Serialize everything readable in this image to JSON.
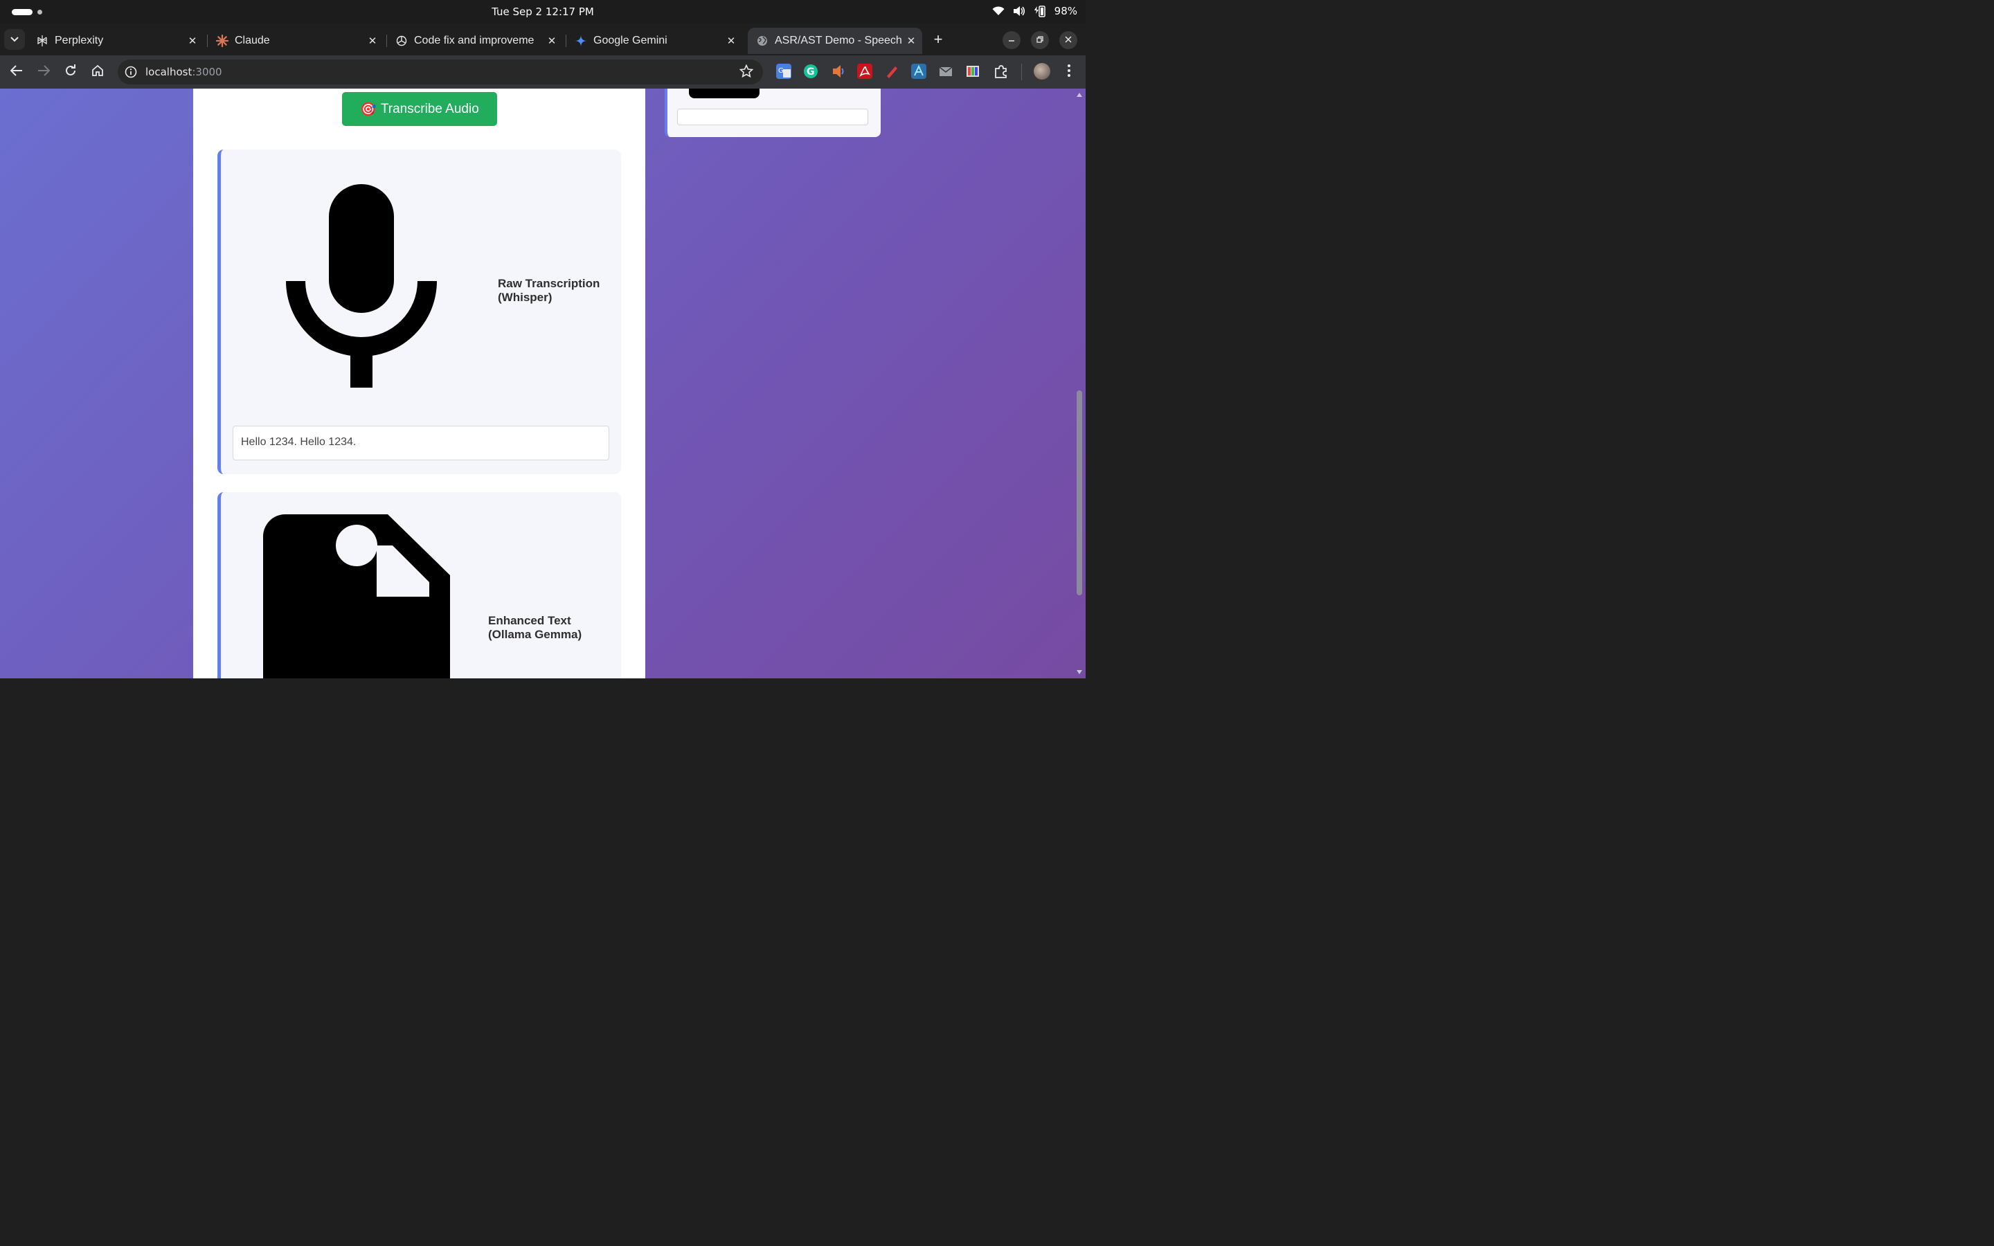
{
  "os": {
    "datetime": "Tue Sep 2  12:17 PM",
    "battery": "98%",
    "icons": [
      "wifi-icon",
      "volume-icon",
      "battery-icon"
    ]
  },
  "browser": {
    "tabs": [
      {
        "title": "Perplexity",
        "icon": "perplexity-icon",
        "active": false
      },
      {
        "title": "Claude",
        "icon": "claude-icon",
        "active": false
      },
      {
        "title": "Code fix and improveme",
        "icon": "chatgpt-icon",
        "active": false
      },
      {
        "title": "Google Gemini",
        "icon": "gemini-icon",
        "active": false
      },
      {
        "title": "ASR/AST Demo - Speech",
        "icon": "globe-icon",
        "active": true
      }
    ],
    "url_host": "localhost",
    "url_port": ":3000",
    "extensions": [
      "google-translate-icon",
      "grammarly-icon",
      "extension-icon",
      "acrobat-icon",
      "pen-icon",
      "font-icon",
      "mail-icon",
      "color-picker-icon",
      "puzzle-icon"
    ],
    "accent": "#667eea"
  },
  "page": {
    "transcribe_button": {
      "emoji": "🎯",
      "label": "Transcribe Audio"
    },
    "raw_section": {
      "label": "Raw Transcription (Whisper)",
      "value": "Hello 1234. Hello 1234.",
      "icon": "microphone-icon"
    },
    "enhanced_section": {
      "label": "Enhanced Text (Ollama Gemma)",
      "icon": "image-file-icon"
    },
    "colors": {
      "button_green": "#22ad5c",
      "gradient_start": "#6b6fd0",
      "gradient_end": "#764ba2"
    }
  }
}
